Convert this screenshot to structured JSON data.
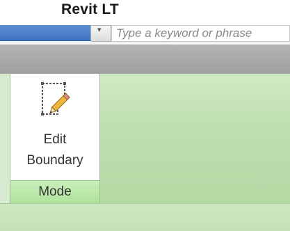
{
  "app": {
    "title": "Revit LT"
  },
  "search": {
    "placeholder": "Type a keyword or phrase"
  },
  "ribbon": {
    "panel": {
      "title": "Mode",
      "button": {
        "label_line1": "Edit",
        "label_line2": "Boundary",
        "icon": "edit-boundary-icon"
      }
    }
  },
  "colors": {
    "title_bar_accent": "#3f74c1",
    "ribbon_green": "#bfe0b0",
    "panel_footer_green": "#c8efb9"
  }
}
